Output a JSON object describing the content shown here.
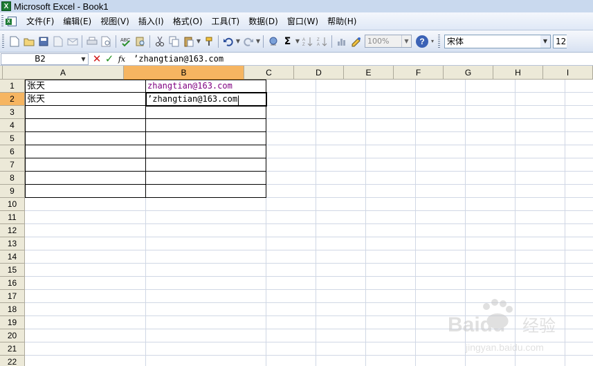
{
  "titlebar": {
    "title": "Microsoft Excel - Book1",
    "icon": "excel-icon"
  },
  "menu": {
    "items": [
      "文件(F)",
      "编辑(E)",
      "视图(V)",
      "插入(I)",
      "格式(O)",
      "工具(T)",
      "数据(D)",
      "窗口(W)",
      "帮助(H)"
    ]
  },
  "toolbar": {
    "zoom": "100%",
    "font_name": "宋体",
    "font_size": "12",
    "autosum_symbol": "Σ",
    "help_symbol": "?"
  },
  "formula_bar": {
    "cell_ref": "B2",
    "cancel_symbol": "✕",
    "enter_symbol": "✓",
    "fx_label": "fx",
    "content": "’zhangtian@163.com"
  },
  "columns": [
    "A",
    "B",
    "C",
    "D",
    "E",
    "F",
    "G",
    "H",
    "I"
  ],
  "active_column": "B",
  "active_row": "2",
  "rows": [
    {
      "num": "1",
      "A": "张天",
      "B": "zhangtian@163.com"
    },
    {
      "num": "2",
      "A": "张天",
      "B": "’zhangtian@163.com"
    },
    {
      "num": "3"
    },
    {
      "num": "4"
    },
    {
      "num": "5"
    },
    {
      "num": "6"
    },
    {
      "num": "7"
    },
    {
      "num": "8"
    },
    {
      "num": "9"
    },
    {
      "num": "10"
    },
    {
      "num": "11"
    },
    {
      "num": "12"
    },
    {
      "num": "13"
    },
    {
      "num": "14"
    },
    {
      "num": "15"
    },
    {
      "num": "16"
    },
    {
      "num": "17"
    },
    {
      "num": "18"
    },
    {
      "num": "19"
    },
    {
      "num": "20"
    },
    {
      "num": "21"
    },
    {
      "num": "22"
    }
  ],
  "watermark": {
    "brand": "Baidu",
    "brand_cn": "经验",
    "url": "jingyan.baidu.com"
  },
  "colors": {
    "active_header": "#f6b561",
    "hyperlink": "#800080",
    "header_bg": "#ece9d8"
  }
}
